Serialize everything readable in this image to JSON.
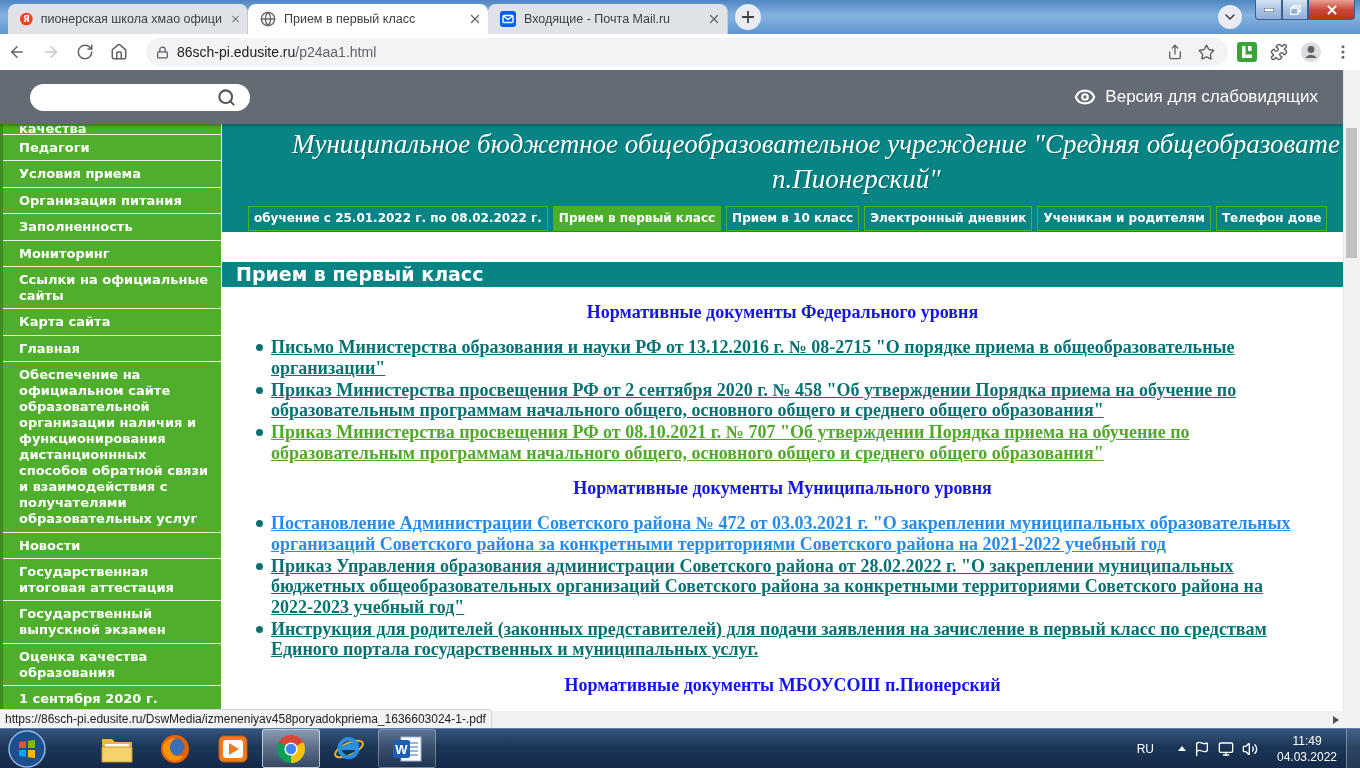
{
  "browser": {
    "tabs": [
      {
        "title": "пионерская школа хмао офици",
        "kind": "letter",
        "icon_text": "Я",
        "selected": false
      },
      {
        "title": "Прием в первый класс",
        "kind": "globe",
        "selected": true
      },
      {
        "title": "Входящие - Почта Mail.ru",
        "kind": "mail",
        "selected": false
      }
    ],
    "toolbar": [
      {
        "kind": "back",
        "disabled": false
      },
      {
        "kind": "forward",
        "disabled": true
      },
      {
        "kind": "reload",
        "disabled": false
      },
      {
        "kind": "home",
        "disabled": false
      }
    ],
    "address": {
      "host": "86sch-pi.edusite.ru",
      "path": "/p24aa1.html"
    }
  },
  "page": {
    "accessibility_link": "Версия для слабовидящих",
    "sidebar": {
      "items": [
        "качества",
        "Педагоги",
        "Условия приема",
        "Организация питания",
        "Заполненность",
        "Мониторинг",
        "Ссылки на официальные сайты",
        "Карта сайта",
        "Главная",
        "Обеспечение на официальном сайте образовательной организации наличия и функционирования дистанционнных способов обратной связи и взаимодействия с получателями образовательных услуг",
        "Новости",
        "Государственная итоговая аттестация",
        "Государственный выпускной экзамен",
        "Оценка качества образования",
        "1 сентября 2020 г."
      ]
    },
    "header": {
      "title_lines": [
        "Муниципальное бюджетное общеобразовательное учреждение \"Средняя общеобразовате",
        "п.Пионерский\""
      ],
      "menu": [
        {
          "label": "обучение с 25.01.2022 г. по 08.02.2022 г.",
          "selected": false
        },
        {
          "label": "Прием в первый класс",
          "selected": true
        },
        {
          "label": "Прием в 10 класс",
          "selected": false
        },
        {
          "label": "Электронный дневник",
          "selected": false
        },
        {
          "label": "Ученикам и родителям",
          "selected": false
        },
        {
          "label": "Телефон дове",
          "selected": false
        }
      ]
    },
    "section_title": "Прием в первый класс",
    "sections": [
      {
        "heading": "Нормативные документы Федерального уровня",
        "links": [
          {
            "text": "Письмо Министерства образования и науки РФ от 13.12.2016 г. № 08-2715 \"О порядке приема в общеобразовательные организации\"",
            "color": "#087272"
          },
          {
            "text": "Приказ Министерства просвещения РФ от 2 сентября 2020 г. № 458 \"Об утверждении Порядка приема на обучение по образовательным программам начального общего, основного общего и среднего общего образования\"",
            "color": "#087272"
          },
          {
            "text": "Приказ Министерства просвещения РФ от 08.10.2021 г. № 707 \"Об утверждении Порядка приема на обучение по образовательным программам начального общего, основного общего и среднего общего образования\"",
            "color": "#52a82c"
          }
        ]
      },
      {
        "heading": "Нормативные документы Муниципального уровня",
        "links": [
          {
            "text": "Постановление Администрации Советского района № 472 от 03.03.2021 г. \"О закреплении муниципальных образовательных организаций Советского района за конкретными территориями Советского района на 2021-2022 учебный год",
            "color": "#2a8be6"
          },
          {
            "text": "Приказ Управления образования администрации Советского района от 28.02.2022 г. \"О закреплении муниципальных бюджетных общеобразовательных организаций Советского района за конкретными территориями Советского района на 2022-2023 учебный год\"",
            "color": "#087272"
          },
          {
            "text": "Инструкция для родителей (законных представителей) для подачи заявления на зачисление в первый класс по средствам Единого портала государственных и муниципальных услуг.",
            "color": "#087272"
          }
        ]
      },
      {
        "heading": "Нормативные документы МБОУСОШ п.Пионерский"
      }
    ]
  },
  "status_url": "https://86sch-pi.edusite.ru/DswMedia/izmeneniyav458poryadokpriema_1636603024-1-.pdf",
  "taskbar": {
    "apps": [
      {
        "kind": "explorer",
        "running": false,
        "selected": false
      },
      {
        "kind": "firefox",
        "running": false,
        "selected": false
      },
      {
        "kind": "player",
        "running": false,
        "selected": false
      },
      {
        "kind": "chrome",
        "running": true,
        "selected": true
      },
      {
        "kind": "ie",
        "running": false,
        "selected": false
      },
      {
        "kind": "word",
        "glyph": "W",
        "running": true,
        "selected": false
      }
    ],
    "language": "RU",
    "time": "11:49",
    "date": "04.03.2022"
  }
}
